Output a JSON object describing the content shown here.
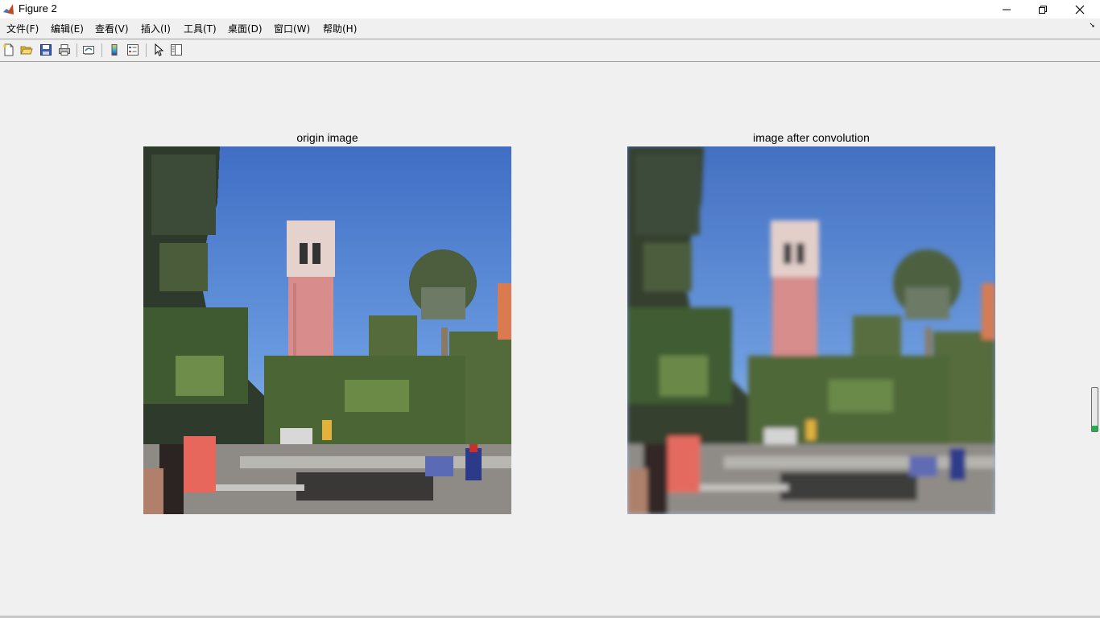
{
  "window": {
    "title": "Figure 2",
    "controls": [
      "minimize-icon",
      "restore-icon",
      "close-icon"
    ]
  },
  "menubar": {
    "items": [
      "文件(F)",
      "编辑(E)",
      "查看(V)",
      "插入(I)",
      "工具(T)",
      "桌面(D)",
      "窗口(W)",
      "帮助(H)"
    ],
    "overflow_arrow": "➘"
  },
  "toolbar": {
    "buttons": [
      "new-figure-icon",
      "open-file-icon",
      "save-icon",
      "print-icon",
      "link-plot-icon",
      "colorbar-icon",
      "legend-icon",
      "edit-plot-icon",
      "property-inspector-icon"
    ]
  },
  "figure": {
    "left_axes": {
      "title": "origin image"
    },
    "right_axes": {
      "title": "image after convolution"
    }
  },
  "colors": {
    "background": "#f0f0f0",
    "sky": "#5a8ad8",
    "tower": "#d89090",
    "scroll_indicator": "#1fb14c"
  }
}
